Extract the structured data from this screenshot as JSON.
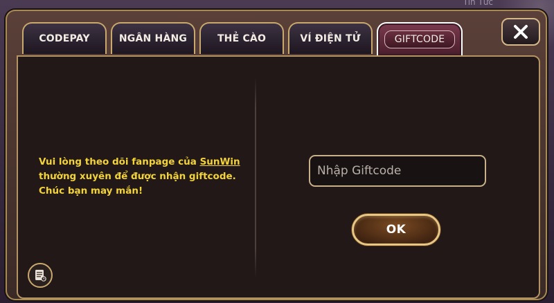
{
  "background": {
    "news_label": "Tin Tức"
  },
  "tabs": [
    {
      "label": "CODEPAY",
      "active": false
    },
    {
      "label": "NGÂN HÀNG",
      "active": false
    },
    {
      "label": "THẺ CÀO",
      "active": false
    },
    {
      "label": "VÍ ĐIỆN TỬ",
      "active": false
    },
    {
      "label": "GIFTCODE",
      "active": true
    }
  ],
  "info": {
    "text_before": "Vui lòng theo dõi fanpage của ",
    "brand": "SunWin",
    "text_line2": "thường xuyên để được nhận giftcode.",
    "text_line3": "Chúc bạn may mắn!"
  },
  "giftcode": {
    "placeholder": "Nhập Giftcode",
    "value": "",
    "submit_label": "OK"
  },
  "icons": {
    "close": "close-icon",
    "history": "history-icon"
  },
  "colors": {
    "accent_gold": "#c9a96e",
    "note_yellow": "#f3d33a",
    "panel_bg": "#211817",
    "active_tab": "#7a3a4e"
  }
}
